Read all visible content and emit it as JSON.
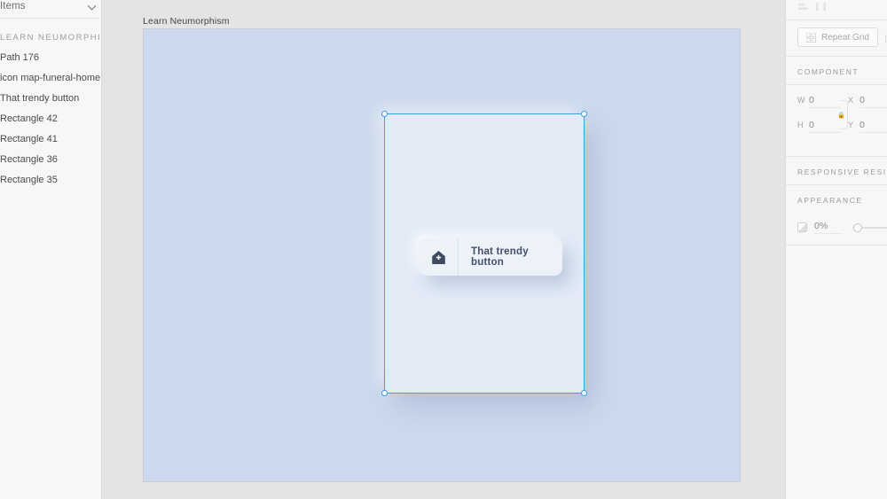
{
  "layers_panel": {
    "header_label": "Items",
    "header_icon": "chevron-down-icon",
    "group_label": "LEARN NEUMORPHISM",
    "items": [
      {
        "label": "Path 176"
      },
      {
        "label": "icon map-funeral-home"
      },
      {
        "label": "That trendy button"
      },
      {
        "label": "Rectangle 42"
      },
      {
        "label": "Rectangle 41"
      },
      {
        "label": "Rectangle 36"
      },
      {
        "label": "Rectangle 35"
      }
    ]
  },
  "canvas": {
    "artboard_label": "Learn Neumorphism",
    "artboard_bg": "#ccd9ee",
    "canvas_bg": "#e4e4e4",
    "selection_color": "#3aa0e0",
    "card_bg": "#e3ebf7",
    "button": {
      "label": "That trendy button",
      "icon": "house-cross-icon",
      "bg": "#edf2f9",
      "text_color": "#44506a"
    }
  },
  "properties_panel": {
    "repeat_grid": {
      "label": "Repeat Grid",
      "icon": "grid-four-icon",
      "stack_icon": "stack-icon"
    },
    "component_section": {
      "title": "COMPONENT",
      "fields": [
        {
          "key": "W",
          "value": "0"
        },
        {
          "key": "X",
          "value": "0"
        },
        {
          "key": "H",
          "value": "0"
        },
        {
          "key": "Y",
          "value": "0"
        }
      ],
      "link_icon": "lock-aspect-icon"
    },
    "responsive_section": {
      "title": "RESPONSIVE RESIZE"
    },
    "appearance_section": {
      "title": "APPEARANCE",
      "opacity_icon": "opacity-icon",
      "opacity_value": "0%"
    }
  }
}
